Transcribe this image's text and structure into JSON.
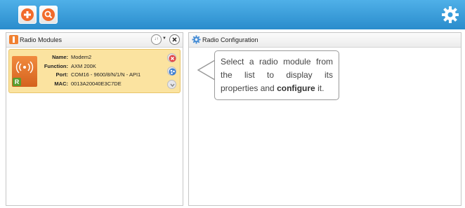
{
  "toolbar": {
    "add_icon": "plus-circle-icon",
    "search_icon": "magnifier-icon",
    "settings_icon": "gear-icon"
  },
  "left_panel": {
    "title": "Radio Modules",
    "module": {
      "fields": [
        {
          "label": "Name:",
          "value": "Modem2"
        },
        {
          "label": "Function:",
          "value": "AXM 200K"
        },
        {
          "label": "Port:",
          "value": "COM16 - 9600/8/N/1/N - API1"
        },
        {
          "label": "MAC:",
          "value": "0013A20040E3C7DE"
        }
      ],
      "badge": "R"
    }
  },
  "right_panel": {
    "title": "Radio Configuration",
    "callout": {
      "text_before": "Select a radio module from the list to display its properties and ",
      "text_bold": "configure",
      "text_after": " it."
    }
  },
  "colors": {
    "toolbar": "#3a9ddc",
    "accent_orange": "#f26a2a",
    "card_bg": "#fbe3a0"
  }
}
